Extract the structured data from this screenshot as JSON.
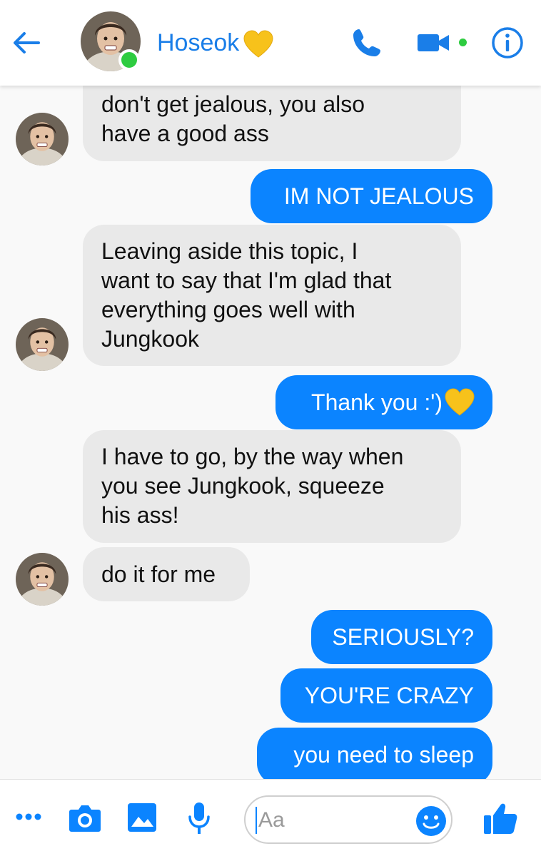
{
  "header": {
    "contact_name": "Hoseok",
    "accent_color": "#1a7ee8",
    "icons": [
      "back-arrow-icon",
      "phone-icon",
      "video-camera-icon",
      "info-icon",
      "yellow-heart-icon"
    ]
  },
  "messages": [
    {
      "direction": "incoming",
      "lines": [
        "don't get jealous, you also",
        "have a good ass"
      ]
    },
    {
      "direction": "outgoing",
      "lines": [
        "IM NOT JEALOUS"
      ]
    },
    {
      "direction": "incoming",
      "lines": [
        "Leaving aside this topic, I",
        "want to say that I'm glad that",
        "everything goes well with",
        "Jungkook"
      ]
    },
    {
      "direction": "outgoing",
      "lines": [
        "Thank you :')"
      ],
      "emoji": "yellow-heart"
    },
    {
      "direction": "incoming",
      "lines": [
        "I have to go, by the way when",
        "you see Jungkook, squeeze",
        "his ass!"
      ]
    },
    {
      "direction": "incoming",
      "lines": [
        "do it for me"
      ]
    },
    {
      "direction": "outgoing",
      "lines": [
        "SERIOUSLY?"
      ]
    },
    {
      "direction": "outgoing",
      "lines": [
        "YOU'RE CRAZY"
      ]
    },
    {
      "direction": "outgoing",
      "lines": [
        "you need to sleep"
      ]
    }
  ],
  "composer": {
    "placeholder": "Aa",
    "icons": [
      "more-icon",
      "camera-icon",
      "gallery-icon",
      "microphone-icon",
      "emoji-icon",
      "thumbs-up-icon"
    ]
  },
  "colors": {
    "outgoing_bubble": "#0b84ff",
    "incoming_bubble": "#e9e9e9",
    "online": "#2ecc40"
  }
}
